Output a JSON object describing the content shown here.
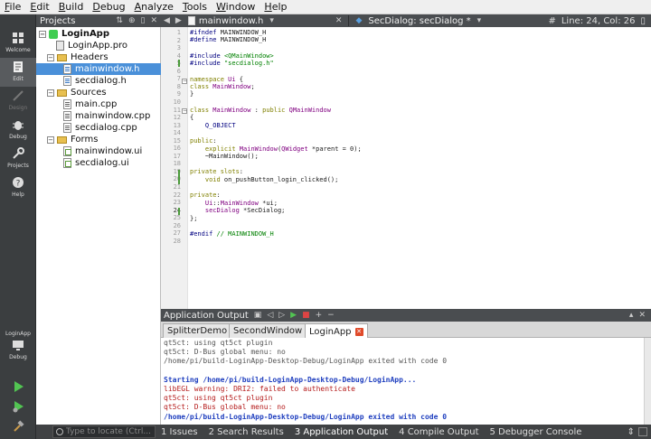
{
  "menubar": {
    "items": [
      {
        "label": "File",
        "u": "F",
        "rest": "ile"
      },
      {
        "label": "Edit",
        "u": "E",
        "rest": "dit"
      },
      {
        "label": "Build",
        "u": "B",
        "rest": "uild"
      },
      {
        "label": "Debug",
        "u": "D",
        "rest": "ebug"
      },
      {
        "label": "Analyze",
        "u": "A",
        "rest": "nalyze"
      },
      {
        "label": "Tools",
        "u": "T",
        "rest": "ools"
      },
      {
        "label": "Window",
        "u": "W",
        "rest": "indow"
      },
      {
        "label": "Help",
        "u": "H",
        "rest": "elp"
      }
    ]
  },
  "modes": {
    "welcome": "Welcome",
    "edit": "Edit",
    "design": "Design",
    "debug": "Debug",
    "projects": "Projects",
    "help": "Help"
  },
  "target": {
    "project": "LoginApp",
    "config": "Debug"
  },
  "projects_pane": {
    "title": "Projects",
    "tree": {
      "root": "LoginApp",
      "pro_file": "LoginApp.pro",
      "headers": "Headers",
      "header_files": [
        "mainwindow.h",
        "secdialog.h"
      ],
      "sources": "Sources",
      "source_files": [
        "main.cpp",
        "mainwindow.cpp",
        "secdialog.cpp"
      ],
      "forms": "Forms",
      "form_files": [
        "mainwindow.ui",
        "secdialog.ui"
      ]
    }
  },
  "editor_toolbar": {
    "file": "mainwindow.h",
    "symbol": "SecDialog: secDialog *",
    "hash": "#",
    "position": "Line: 24, Col: 26"
  },
  "editor": {
    "current_line": 24,
    "line_numbers": [
      "1",
      "2",
      "3",
      "4",
      "5",
      "6",
      "7",
      "8",
      "9",
      "10",
      "11",
      "12",
      "13",
      "14",
      "15",
      "16",
      "17",
      "18",
      "19",
      "20",
      "21",
      "22",
      "23",
      "24",
      "25",
      "26",
      "27",
      "28"
    ]
  },
  "output_pane": {
    "title": "Application Output",
    "tabs": [
      "SplitterDemo",
      "SecondWindow",
      "LoginApp"
    ],
    "close_glyph": "✕",
    "lines": [
      {
        "text": "qt5ct: using qt5ct plugin",
        "style": "gray"
      },
      {
        "text": "qt5ct: D-Bus global menu: no",
        "style": "gray"
      },
      {
        "text": "/home/pi/build-LoginApp-Desktop-Debug/LoginApp exited with code 0",
        "style": "gray"
      },
      {
        "text": "",
        "style": "gray"
      },
      {
        "text": "Starting /home/pi/build-LoginApp-Desktop-Debug/LoginApp...",
        "style": "blue"
      },
      {
        "text": "libEGL warning: DRI2: failed to authenticate",
        "style": "red"
      },
      {
        "text": "qt5ct: using qt5ct plugin",
        "style": "red"
      },
      {
        "text": "qt5ct: D-Bus global menu: no",
        "style": "red"
      },
      {
        "text": "/home/pi/build-LoginApp-Desktop-Debug/LoginApp exited with code 0",
        "style": "blue"
      }
    ]
  },
  "statusbar": {
    "locator_placeholder": "Type to locate (Ctrl...",
    "panes": [
      "1 Issues",
      "2 Search Results",
      "3 Application Output",
      "4 Compile Output",
      "5 Debugger Console"
    ],
    "arrows": "⇕"
  },
  "colors": {
    "selection": "#4a90d9",
    "keyword": "#808000",
    "type": "#800080",
    "string": "#008000",
    "error_red": "#b51c1c",
    "info_blue": "#1f3fbf"
  }
}
